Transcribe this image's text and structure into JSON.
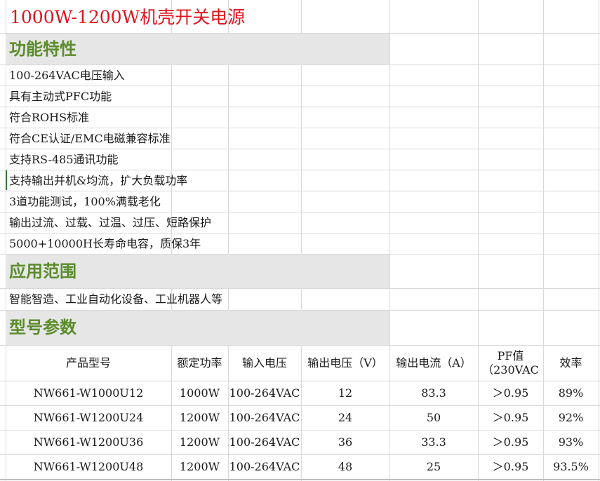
{
  "title": "1000W-1200W机壳开关电源",
  "sections": {
    "features": "功能特性",
    "applications": "应用范围",
    "models": "型号参数"
  },
  "features": [
    "100-264VAC电压输入",
    "具有主动式PFC功能",
    "符合ROHS标准",
    "符合CE认证/EMC电磁兼容标准",
    "支持RS-485通讯功能",
    "支持输出并机&均流，扩大负载功率",
    "3道功能测试，100%满载老化",
    "输出过流、过载、过温、过压、短路保护",
    "5000+10000H长寿命电容，质保3年"
  ],
  "application_text": "智能智造、工业自动化设备、工业机器人等",
  "table": {
    "headers": [
      "产品型号",
      "额定功率",
      "输入电压",
      "输出电压（V）",
      "输出电流（A）",
      "PF值\n（230VAC",
      "效率"
    ],
    "rows": [
      [
        "NW661-W1000U12",
        "1000W",
        "100-264VAC",
        "12",
        "83.3",
        "＞0.95",
        "89%"
      ],
      [
        "NW661-W1200U24",
        "1200W",
        "100-264VAC",
        "24",
        "50",
        "＞0.95",
        "92%"
      ],
      [
        "NW661-W1200U36",
        "1200W",
        "100-264VAC",
        "36",
        "33.3",
        "＞0.95",
        "93%"
      ],
      [
        "NW661-W1200U48",
        "1200W",
        "100-264VAC",
        "48",
        "25",
        "＞0.95",
        "93.5%"
      ]
    ]
  },
  "colors": {
    "title": "#e0141c",
    "section_text": "#5b8c2a",
    "section_band": "#e6e6e6",
    "gridline": "#d9d9d9"
  }
}
